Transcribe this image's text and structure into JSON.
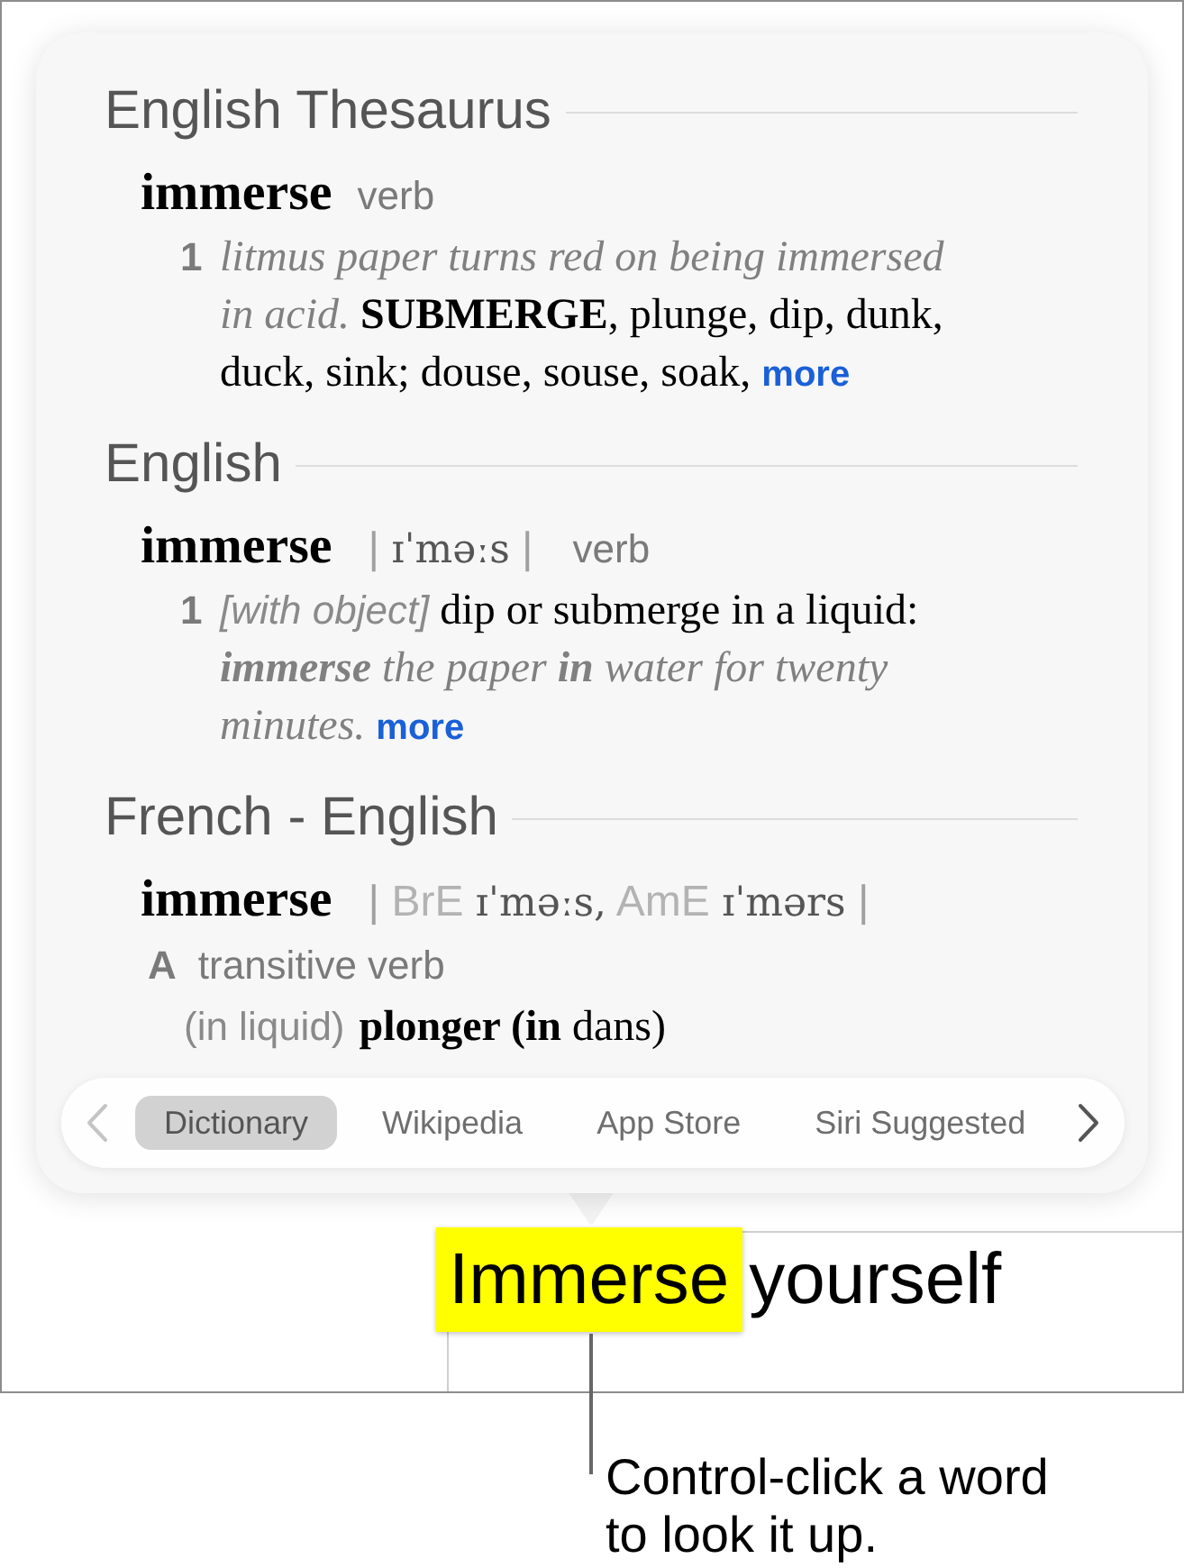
{
  "popover": {
    "sections": [
      {
        "title": "English Thesaurus",
        "headword": "immerse",
        "part_of_speech": "verb",
        "senses": [
          {
            "kind": "thesaurus",
            "number": "1",
            "example": "litmus paper turns red on being immersed in acid.",
            "synonyms": "**SUBMERGE**, plunge, dip, dunk, duck, sink; douse, souse, soak,",
            "more": "more"
          }
        ]
      },
      {
        "title": "English",
        "headword": "immerse",
        "pronunciation": [
          {
            "kind": "bar",
            "text": "|"
          },
          {
            "kind": "ipa",
            "text": "ɪˈməːs"
          },
          {
            "kind": "bar",
            "text": "|"
          }
        ],
        "part_of_speech": "verb",
        "senses": [
          {
            "kind": "definition",
            "number": "1",
            "grammar": "[with object]",
            "definition": "dip or submerge in a liquid:",
            "example": "**immerse** the paper **in** water for twenty minutes.",
            "more": "more"
          }
        ]
      },
      {
        "title": "French - English",
        "headword": "immerse",
        "pronunciation": [
          {
            "kind": "bar",
            "text": "|"
          },
          {
            "kind": "label",
            "text": "BrE"
          },
          {
            "kind": "ipa",
            "text": "ɪˈməːs,"
          },
          {
            "kind": "label",
            "text": "AmE"
          },
          {
            "kind": "ipa",
            "text": "ɪˈmərs"
          },
          {
            "kind": "bar",
            "text": "|"
          }
        ],
        "senses": [
          {
            "kind": "translation",
            "letter": "A",
            "part_of_speech": "transitive verb",
            "context": "(in liquid)",
            "translation": "**plonger (in** dans)"
          }
        ]
      }
    ],
    "tabs": [
      {
        "label": "Dictionary",
        "selected": true
      },
      {
        "label": "Wikipedia",
        "selected": false
      },
      {
        "label": "App Store",
        "selected": false
      },
      {
        "label": "Siri Suggested",
        "selected": false
      }
    ],
    "previous_button": {
      "disabled": true
    },
    "next_button": {
      "disabled": false
    }
  },
  "document": {
    "words": [
      {
        "text": "Immerse",
        "highlighted": true
      },
      {
        "text": "yourself",
        "highlighted": false
      }
    ]
  },
  "callout": {
    "text": "Control-click a word to look it up."
  }
}
